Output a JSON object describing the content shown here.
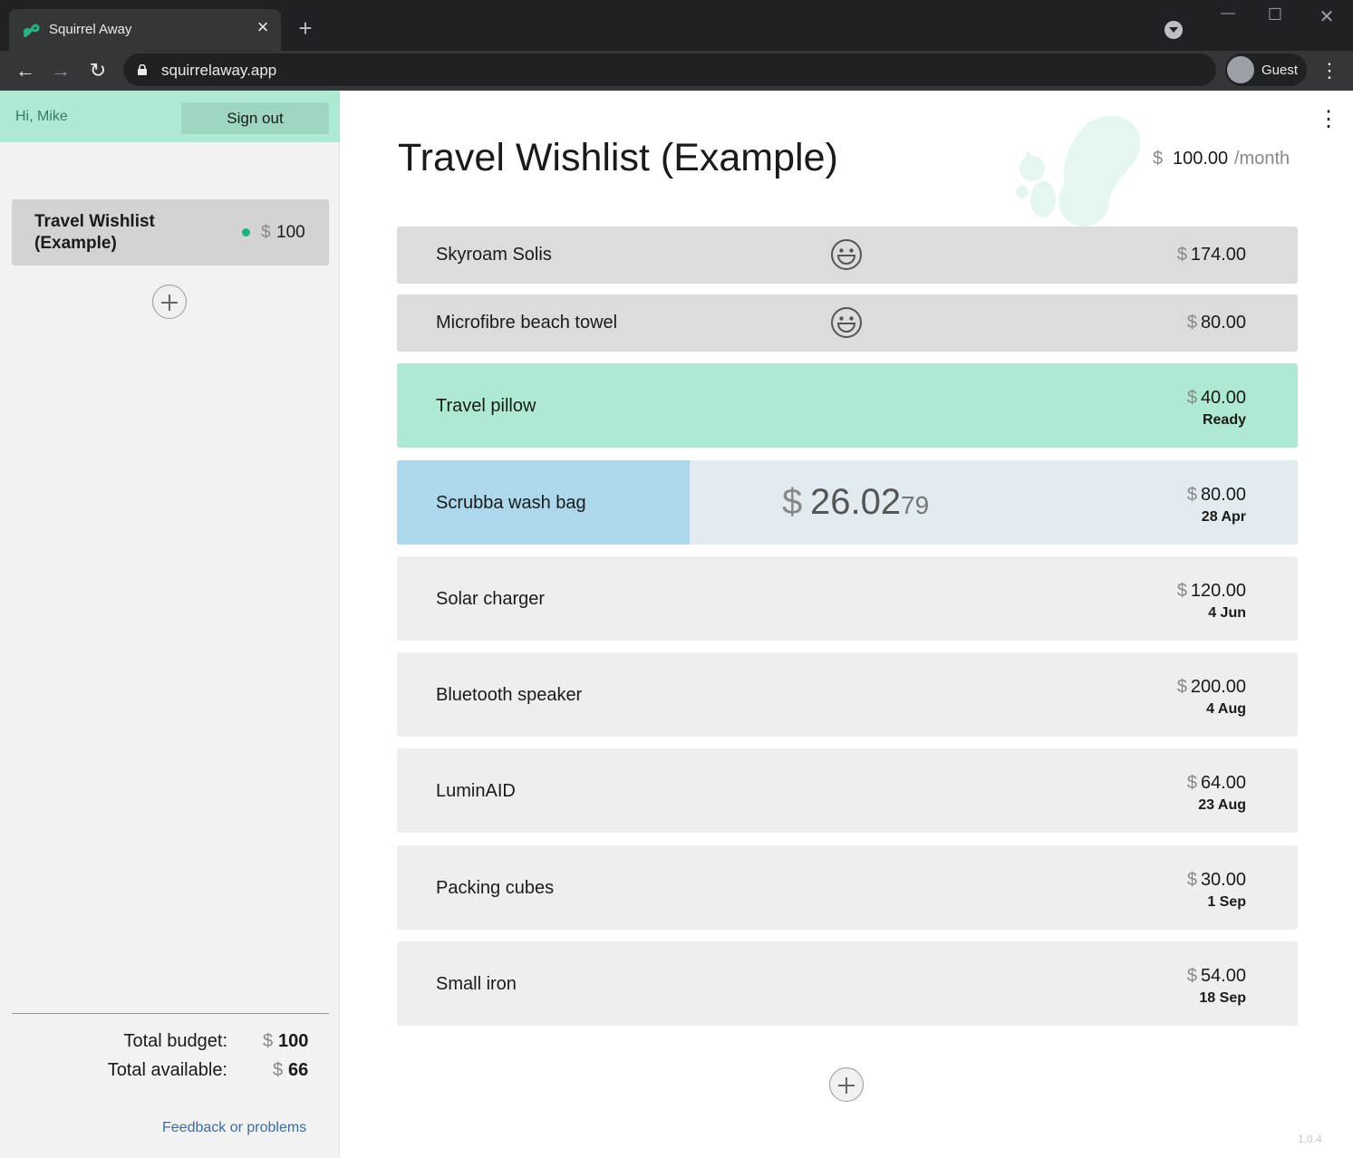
{
  "browser": {
    "tab_title": "Squirrel Away",
    "url": "squirrelaway.app",
    "profile_label": "Guest"
  },
  "sidebar": {
    "greeting": "Hi, Mike",
    "signout_label": "Sign out",
    "lists": [
      {
        "name": "Travel Wishlist (Example)",
        "currency": "$",
        "amount": "100",
        "status_color": "#20b080"
      }
    ],
    "totals": {
      "budget_label": "Total budget:",
      "budget_currency": "$",
      "budget_value": "100",
      "available_label": "Total available:",
      "available_currency": "$",
      "available_value": "66"
    },
    "feedback_label": "Feedback or problems"
  },
  "main": {
    "title": "Travel Wishlist (Example)",
    "budget": {
      "currency": "$",
      "amount": "100.00",
      "unit": "/month"
    },
    "items": [
      {
        "name": "Skyroam Solis",
        "currency": "$",
        "price": "174.00",
        "icon": "smiley-icon",
        "state": "purchased"
      },
      {
        "name": "Microfibre beach towel",
        "currency": "$",
        "price": "80.00",
        "icon": "smiley-icon",
        "state": "purchased"
      },
      {
        "name": "Travel pillow",
        "currency": "$",
        "price": "40.00",
        "sub": "Ready",
        "state": "ready"
      },
      {
        "name": "Scrubba wash bag",
        "currency": "$",
        "price": "80.00",
        "sub": "28 Apr",
        "state": "saving",
        "saved_currency": "$",
        "saved_amount": "26.02",
        "saved_fraction": "79",
        "progress": 0.3253
      },
      {
        "name": "Solar charger",
        "currency": "$",
        "price": "120.00",
        "sub": "4 Jun",
        "state": "pending"
      },
      {
        "name": "Bluetooth speaker",
        "currency": "$",
        "price": "200.00",
        "sub": "4 Aug",
        "state": "pending"
      },
      {
        "name": "LuminAID",
        "currency": "$",
        "price": "64.00",
        "sub": "23 Aug",
        "state": "pending"
      },
      {
        "name": "Packing cubes",
        "currency": "$",
        "price": "30.00",
        "sub": "1 Sep",
        "state": "pending"
      },
      {
        "name": "Small iron",
        "currency": "$",
        "price": "54.00",
        "sub": "18 Sep",
        "state": "pending"
      }
    ],
    "version": "1.0.4"
  },
  "colors": {
    "accent_green": "#aeead3",
    "saving_blue": "#add7ea",
    "saving_bg": "#e1ebf0",
    "purchased_bg": "#dcdcdc",
    "pending_bg": "#eeeeee"
  }
}
